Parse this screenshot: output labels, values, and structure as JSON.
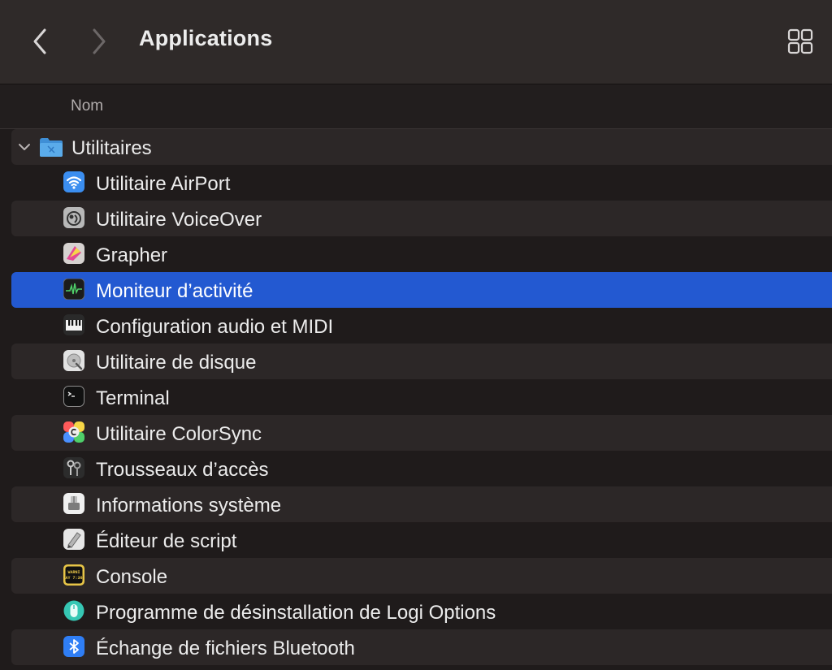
{
  "window": {
    "title": "Applications",
    "icons": {
      "back": "chevron-left-icon",
      "forward": "chevron-right-icon",
      "view": "grid-view-icon"
    }
  },
  "columns": {
    "name": "Nom"
  },
  "folder": {
    "label": "Utilitaires",
    "icon": "folder-icon",
    "expanded": true
  },
  "items": [
    {
      "label": "Utilitaire AirPort",
      "icon": "airport-utility-icon"
    },
    {
      "label": "Utilitaire VoiceOver",
      "icon": "voiceover-utility-icon"
    },
    {
      "label": "Grapher",
      "icon": "grapher-icon"
    },
    {
      "label": "Moniteur d’activité",
      "icon": "activity-monitor-icon",
      "selected": true
    },
    {
      "label": "Configuration audio et MIDI",
      "icon": "audio-midi-setup-icon"
    },
    {
      "label": "Utilitaire de disque",
      "icon": "disk-utility-icon"
    },
    {
      "label": "Terminal",
      "icon": "terminal-icon"
    },
    {
      "label": "Utilitaire ColorSync",
      "icon": "colorsync-utility-icon"
    },
    {
      "label": "Trousseaux d’accès",
      "icon": "keychain-access-icon"
    },
    {
      "label": "Informations système",
      "icon": "system-information-icon"
    },
    {
      "label": "Éditeur de script",
      "icon": "script-editor-icon"
    },
    {
      "label": "Console",
      "icon": "console-icon",
      "icon_text": [
        "WARNI",
        "AY 7:36"
      ]
    },
    {
      "label": "Programme de désinstallation de Logi Options",
      "icon": "logi-options-uninstaller-icon"
    },
    {
      "label": "Échange de fichiers Bluetooth",
      "icon": "bluetooth-file-exchange-icon"
    }
  ],
  "colors": {
    "selection": "#2359d1",
    "row_alt": "#2c2727",
    "background": "#1f1b1b",
    "toolbar": "#2f2a29"
  }
}
